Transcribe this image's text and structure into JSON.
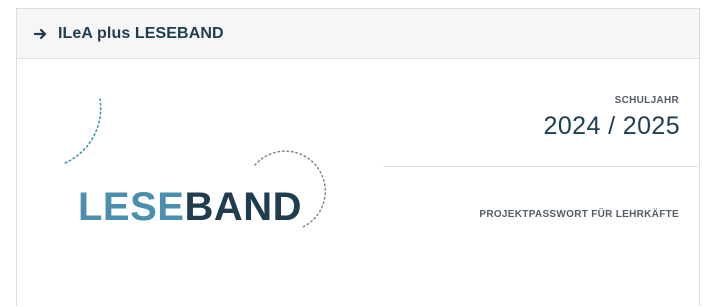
{
  "header": {
    "icon": "arrow-right-icon",
    "title": "ILeA plus LESEBAND"
  },
  "logo": {
    "part1": "LESE",
    "part2": "BAND",
    "colors": {
      "lese": "#4a8fae",
      "band": "#1f3d4f"
    }
  },
  "school_year": {
    "label": "SCHULJAHR",
    "value": "2024 / 2025"
  },
  "password": {
    "label": "PROJEKTPASSWORT FÜR LEHRKÄFTE"
  },
  "colors": {
    "header_bg": "#f6f6f6",
    "accent_dark": "#1f3d4f",
    "accent_blue": "#4a8fae"
  }
}
